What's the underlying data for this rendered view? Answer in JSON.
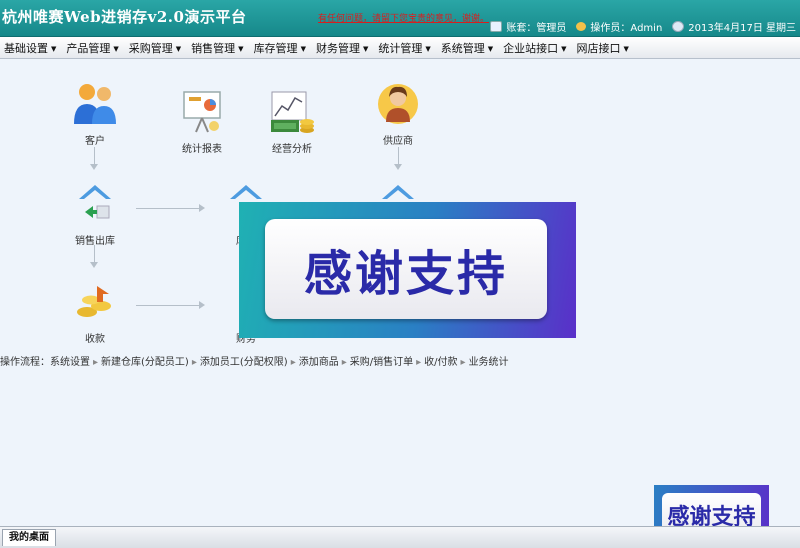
{
  "header": {
    "title": "杭州唯赛Web进销存v2.0演示平台",
    "notice": "有任何问题，请留下您宝贵的意见，谢谢。",
    "account_label": "账套：管理员",
    "operator_label": "操作员：Admin",
    "date_label": "2013年4月17日 星期三"
  },
  "menu": [
    {
      "label": "基础设置"
    },
    {
      "label": "产品管理"
    },
    {
      "label": "采购管理"
    },
    {
      "label": "销售管理"
    },
    {
      "label": "库存管理"
    },
    {
      "label": "财务管理"
    },
    {
      "label": "统计管理"
    },
    {
      "label": "系统管理"
    },
    {
      "label": "企业站接口"
    },
    {
      "label": "网店接口"
    }
  ],
  "flow": {
    "customer": "客户",
    "stats_report": "统计报表",
    "biz_analysis": "经营分析",
    "supplier": "供应商",
    "sales_out": "销售出库",
    "stock": "库存",
    "receipt": "收款",
    "finance": "财务"
  },
  "process": {
    "label": "操作流程：",
    "steps": [
      "系统设置",
      "新建仓库(分配员工)",
      "添加员工(分配权限)",
      "添加商品",
      "采购/销售订单",
      "收/付款",
      "业务统计"
    ]
  },
  "overlay": {
    "text": "感谢支持"
  },
  "badge": {
    "text": "感谢支持"
  },
  "taskbar": {
    "tab": "我的桌面"
  },
  "colors": {
    "header": "#1c9a9c",
    "notice": "#d81e1e",
    "overlay_text": "#2a2aa8"
  }
}
